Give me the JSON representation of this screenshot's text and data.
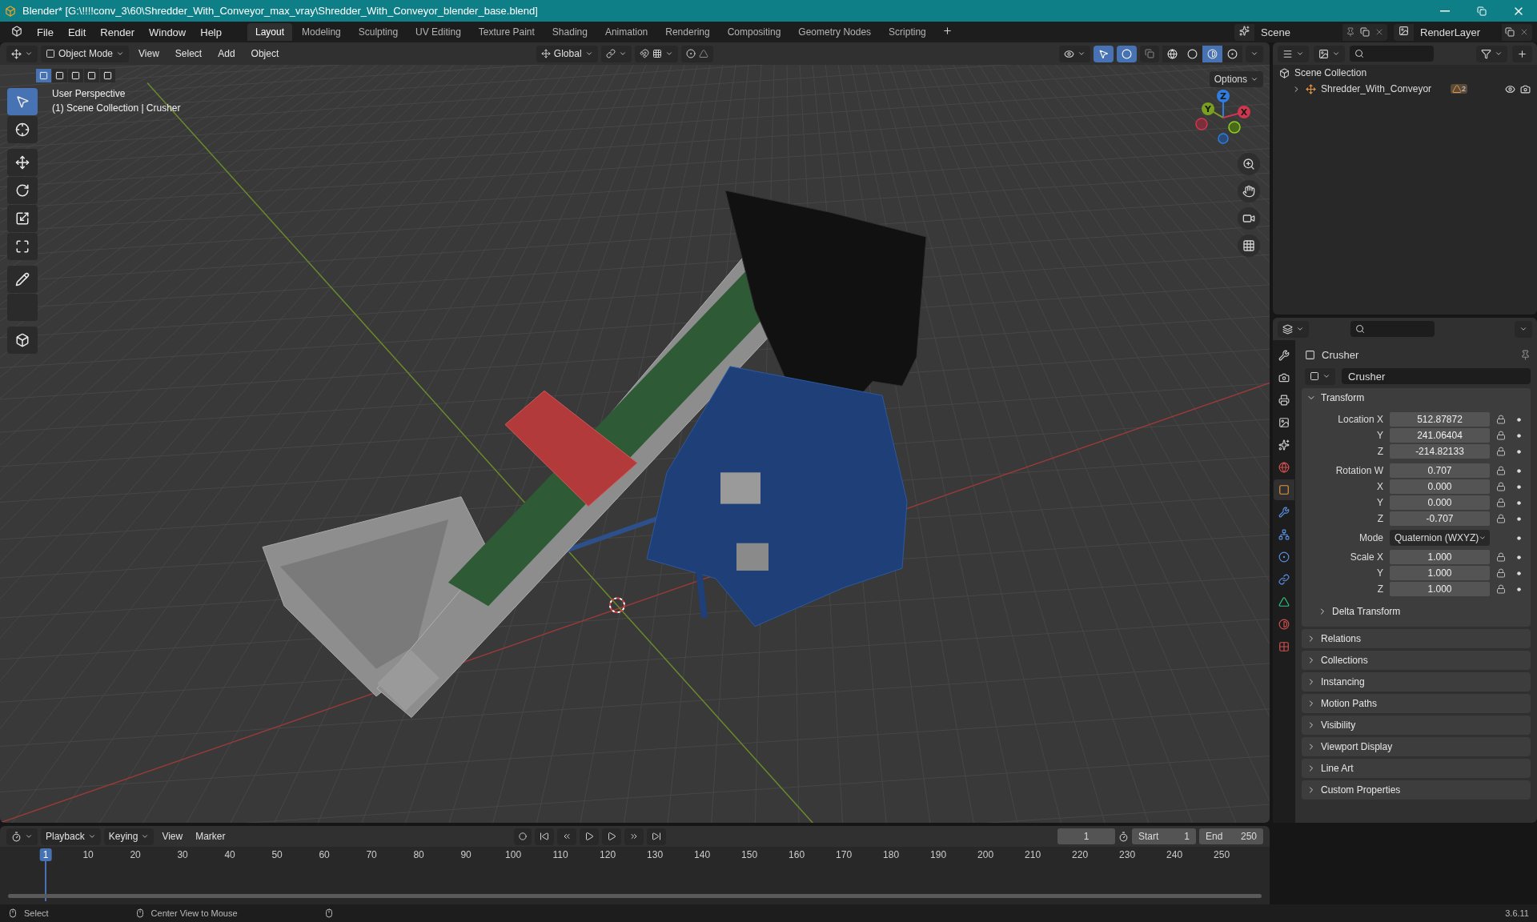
{
  "title_bar": {
    "title": "Blender* [G:\\!!!!conv_3\\60\\Shredder_With_Conveyor_max_vray\\Shredder_With_Conveyor_blender_base.blend]"
  },
  "menu": [
    "File",
    "Edit",
    "Render",
    "Window",
    "Help"
  ],
  "workspaces": [
    {
      "label": "Layout",
      "selected": true
    },
    {
      "label": "Modeling",
      "selected": false
    },
    {
      "label": "Sculpting",
      "selected": false
    },
    {
      "label": "UV Editing",
      "selected": false
    },
    {
      "label": "Texture Paint",
      "selected": false
    },
    {
      "label": "Shading",
      "selected": false
    },
    {
      "label": "Animation",
      "selected": false
    },
    {
      "label": "Rendering",
      "selected": false
    },
    {
      "label": "Compositing",
      "selected": false
    },
    {
      "label": "Geometry Nodes",
      "selected": false
    },
    {
      "label": "Scripting",
      "selected": false
    }
  ],
  "scene": {
    "name": "Scene"
  },
  "view_layer": {
    "name": "RenderLayer"
  },
  "viewport_header": {
    "mode": "Object Mode",
    "menus": [
      "View",
      "Select",
      "Add",
      "Object"
    ],
    "orientation": "Global",
    "options": "Options",
    "gizmos_on": true,
    "overlays_on": true,
    "shading": [
      {
        "selected": false
      },
      {
        "selected": false
      },
      {
        "selected": true
      },
      {
        "selected": false
      }
    ]
  },
  "select_modes": [
    {
      "selected": true
    },
    {
      "selected": false
    },
    {
      "selected": false
    },
    {
      "selected": false
    },
    {
      "selected": false
    }
  ],
  "tools": [
    {
      "selected": true
    },
    {
      "selected": false
    },
    {
      "selected": false
    },
    {
      "selected": false
    },
    {
      "selected": false
    },
    {
      "selected": false
    },
    {
      "selected": false
    },
    {
      "selected": false
    },
    {
      "selected": false
    }
  ],
  "viewport": {
    "perspective": "User Perspective",
    "context": "(1) Scene Collection | Crusher",
    "axes": [
      "Z",
      "Y",
      "X"
    ]
  },
  "outliner": {
    "root": "Scene Collection",
    "items": [
      {
        "label": "Shredder_With_Conveyor",
        "badge": "2",
        "expanded": false
      }
    ]
  },
  "property_tabs": [
    {
      "selected": false
    },
    {
      "selected": false
    },
    {
      "selected": false
    },
    {
      "selected": false
    },
    {
      "selected": false
    },
    {
      "selected": false
    },
    {
      "selected": true
    },
    {
      "selected": false
    },
    {
      "selected": false
    },
    {
      "selected": false
    },
    {
      "selected": false
    },
    {
      "selected": false
    },
    {
      "selected": false
    },
    {
      "selected": false
    }
  ],
  "properties": {
    "object": "Crusher",
    "data_name": "Crusher",
    "transform": {
      "title": "Transform",
      "expanded": true,
      "groups": [
        {
          "rows": [
            {
              "label": "Location X",
              "value": "512.87872"
            },
            {
              "label": "Y",
              "value": "241.06404"
            },
            {
              "label": "Z",
              "value": "-214.82133"
            }
          ]
        },
        {
          "rows": [
            {
              "label": "Rotation W",
              "value": "0.707"
            },
            {
              "label": "X",
              "value": "0.000"
            },
            {
              "label": "Y",
              "value": "0.000"
            },
            {
              "label": "Z",
              "value": "-0.707"
            }
          ]
        },
        {
          "mode_label": "Mode",
          "mode": "Quaternion (WXYZ)"
        },
        {
          "rows": [
            {
              "label": "Scale X",
              "value": "1.000"
            },
            {
              "label": "Y",
              "value": "1.000"
            },
            {
              "label": "Z",
              "value": "1.000"
            }
          ]
        }
      ],
      "subpanel": "Delta Transform"
    },
    "panels": [
      "Relations",
      "Collections",
      "Instancing",
      "Motion Paths",
      "Visibility",
      "Viewport Display",
      "Line Art",
      "Custom Properties"
    ]
  },
  "timeline": {
    "menus": [
      {
        "label": "Playback",
        "dropdown": true
      },
      {
        "label": "Keying",
        "dropdown": true
      },
      {
        "label": "View",
        "dropdown": false
      },
      {
        "label": "Marker",
        "dropdown": false
      }
    ],
    "current_frame": "1",
    "start_label": "Start",
    "start": "1",
    "end_label": "End",
    "end": "250",
    "playhead": "1",
    "ticks": [
      "10",
      "20",
      "30",
      "40",
      "50",
      "60",
      "70",
      "80",
      "90",
      "100",
      "110",
      "120",
      "130",
      "140",
      "150",
      "160",
      "170",
      "180",
      "190",
      "200",
      "210",
      "220",
      "230",
      "240",
      "250"
    ]
  },
  "status_bar": {
    "items": [
      "Select",
      "Center View to Mouse"
    ],
    "version": "3.6.11"
  }
}
